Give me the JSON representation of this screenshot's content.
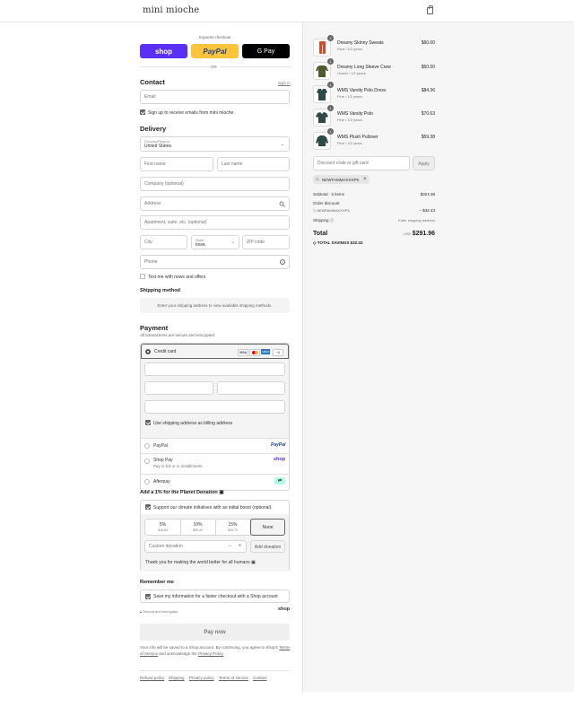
{
  "header": {
    "logo": "mini mioche",
    "cart_icon": "shopping-bag-icon"
  },
  "express": {
    "title": "Express checkout",
    "shop_label": "shop",
    "paypal_label": "PayPal",
    "gpay_label": "G Pay",
    "or": "OR"
  },
  "contact": {
    "title": "Contact",
    "sign_in": "Sign in",
    "email_placeholder": "Email",
    "newsletter": "Sign up to receive emails from mini mioche."
  },
  "delivery": {
    "title": "Delivery",
    "country_label": "Country/Region",
    "country_value": "United States",
    "first_name": "First name",
    "last_name": "Last name",
    "company": "Company (optional)",
    "address": "Address",
    "apartment": "Apartment, suite, etc. (optional)",
    "city": "City",
    "state_label": "State",
    "state_value": "Iowa",
    "zip": "ZIP code",
    "phone": "Phone",
    "text_offers": "Text me with news and offers"
  },
  "shipping": {
    "title": "Shipping method",
    "notice": "Enter your shipping address to view available shipping methods."
  },
  "payment": {
    "title": "Payment",
    "subtitle": "All transactions are secure and encrypted.",
    "credit_card": "Credit card",
    "more_cards": "+4",
    "billing_same": "Use shipping address as billing address",
    "paypal": "PayPal",
    "paypal_logo": "PayPal",
    "shop_pay": "Shop Pay",
    "shop_pay_sub": "Pay in full or in installments",
    "shop_pay_logo": "shop",
    "afterpay": "Afterpay"
  },
  "donation": {
    "title": "Add a 1% for the Planet Donation",
    "support": "Support our climate initiatives with an initial boost (optional).",
    "options": [
      {
        "pct": "5%",
        "amt": "$16.60"
      },
      {
        "pct": "10%",
        "amt": "$29.20"
      },
      {
        "pct": "15%",
        "amt": "$43.79"
      }
    ],
    "none": "None",
    "custom_placeholder": "Custom donation",
    "minus": "−",
    "plus": "+",
    "add_button": "Add donation",
    "thanks": "Thank you for making the world better for all humans"
  },
  "remember": {
    "title": "Remember me",
    "save_info": "Save my information for a faster checkout with a Shop account",
    "secure": "Secure and encrypted",
    "shop_logo": "shop"
  },
  "pay": {
    "button": "Pay now",
    "info_1": "Your info will be saved to a Shop account. By continuing, you agree to Shop's",
    "terms": "Terms of Service",
    "and": "and acknowledge the",
    "privacy": "Privacy Policy"
  },
  "footer": {
    "links": [
      "Refund policy",
      "Shipping",
      "Privacy policy",
      "Terms of service",
      "Contact"
    ]
  },
  "cart": {
    "items": [
      {
        "qty": "1",
        "title": "Dreamy Skinny Sweats",
        "sub": "Rust / 1/2 years",
        "price": "$60.00",
        "color": "#c9532e"
      },
      {
        "qty": "1",
        "title": "Dreamy Long Sleeve Crew",
        "sub": "Hunter / 1/2 years",
        "price": "$50.00",
        "color": "#4f5b2f"
      },
      {
        "qty": "1",
        "title": "WMS Varsity Polo Dress",
        "sub": "Pine / 1/2 years",
        "price": "$84.36",
        "color": "#2f4a44"
      },
      {
        "qty": "1",
        "title": "WMS Varsity Polo",
        "sub": "Pine / 1/2 years",
        "price": "$70.63",
        "color": "#2f4a44"
      },
      {
        "qty": "1",
        "title": "WMS Plush Pullover",
        "sub": "Pine / 1/2 years",
        "price": "$59.38",
        "color": "#2f4a44"
      }
    ],
    "discount_placeholder": "Discount code or gift card",
    "apply": "Apply",
    "code": "NEWFAMMAXXXP5",
    "subtotal_label": "Subtotal · 5 items",
    "subtotal_value": "$324.39",
    "order_discount": "Order discount",
    "discount_code": "NEWFAMMAXXXP5",
    "discount_value": "– $32.43",
    "shipping_label": "Shipping",
    "shipping_value": "Enter shipping address",
    "total_label": "Total",
    "currency": "USD",
    "total_value": "$291.96",
    "savings_label": "TOTAL SAVINGS",
    "savings_value": "$32.43"
  }
}
